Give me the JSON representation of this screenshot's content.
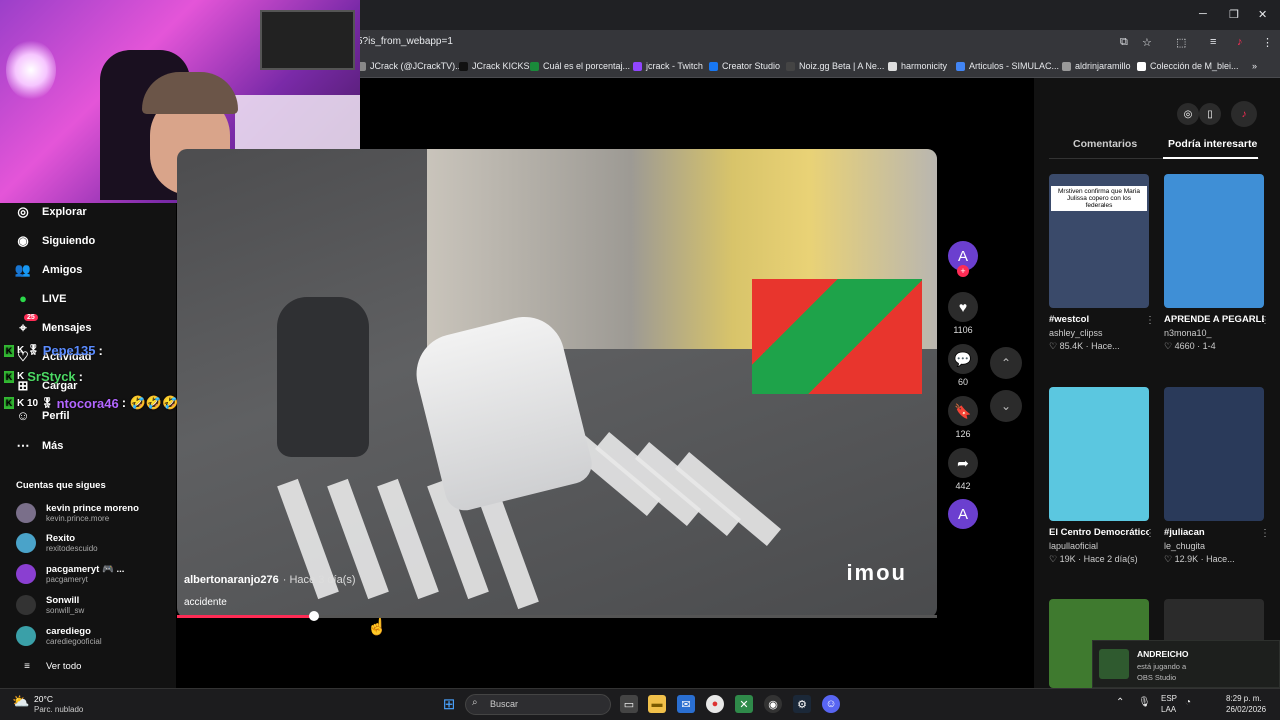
{
  "browser": {
    "url": "5?is_from_webapp=1",
    "bookmarks": [
      "JCrack (@JCrackTV)...",
      "JCrack KICKS",
      "Cuál es el porcentaj...",
      "jcrack - Twitch",
      "Creator Studio",
      "Noiz.gg Beta | A Ne...",
      "harmonicity",
      "Articulos - SIMULAC...",
      "aldrinjaramillo",
      "Colección de M_blei..."
    ],
    "bookmarks_more": "»"
  },
  "sidebar": {
    "nav": [
      {
        "icon": "compass-icon",
        "label": "Explorar"
      },
      {
        "icon": "following-icon",
        "label": "Siguiendo"
      },
      {
        "icon": "friends-icon",
        "label": "Amigos"
      },
      {
        "icon": "live-icon",
        "label": "LIVE"
      },
      {
        "icon": "messages-icon",
        "label": "Mensajes",
        "badge": "25"
      },
      {
        "icon": "activity-icon",
        "label": "Actividad"
      },
      {
        "icon": "upload-icon",
        "label": "Cargar"
      },
      {
        "icon": "profile-icon",
        "label": "Perfil"
      },
      {
        "icon": "more-icon",
        "label": "Más"
      }
    ],
    "following_header": "Cuentas que sigues",
    "following": [
      {
        "name": "kevin prince moreno",
        "handle": "kevin.prince.more",
        "color": "#7a6f8a"
      },
      {
        "name": "Rexito",
        "handle": "rexitodescuido",
        "color": "#4aa3c9"
      },
      {
        "name": "pacgameryt 🎮 ...",
        "handle": "pacgameryt",
        "color": "#8a3fd1"
      },
      {
        "name": "Sonwill",
        "handle": "sonwill_sw",
        "color": "#333333"
      },
      {
        "name": "carediego",
        "handle": "carediegooficial",
        "color": "#3aa0a8"
      }
    ],
    "see_all": "Ver todo"
  },
  "chat": [
    {
      "user": "Pepe135",
      "color": "#5b8cff",
      "text": ":",
      "badges": "K 🎖"
    },
    {
      "user": "SrStyck",
      "color": "#4cd964",
      "text": ":",
      "badges": "K"
    },
    {
      "user": "ntocora46",
      "color": "#b266ff",
      "text": ": 🤣🤣🤣🤣🤣",
      "badges": "K 10 🎖"
    }
  ],
  "video": {
    "author": "albertonaranjo276",
    "time": "· Hace 3 día(s)",
    "description": "accidente",
    "watermark": "imou",
    "progress": 0.18
  },
  "actions": {
    "likes": "1106",
    "comments": "60",
    "saves": "126",
    "shares": "442",
    "avatar_letter": "A"
  },
  "right_panel": {
    "tabs": [
      "Comentarios",
      "Podría interesarte"
    ],
    "active_tab": 1,
    "cards": [
      {
        "title": "#westcol",
        "author": "ashley_clipss",
        "stats": "♡ 85.4K · Hace...",
        "overlay": "Mrstiven confirma que Maria Julissa copero con los federales",
        "bg": "#3a4a6a"
      },
      {
        "title": "APRENDE A PEGARLE BIEN A...",
        "author": "n3mona10_",
        "stats": "♡ 4660 · 1-4",
        "overlay": "",
        "bg": "#3f8fd6"
      },
      {
        "title": "El Centro Democrático...",
        "author": "lapullaoficial",
        "stats": "♡ 19K · Hace 2 día(s)",
        "overlay": "",
        "bg": "#5bc7e0"
      },
      {
        "title": "#juliacan",
        "author": "le_chugita",
        "stats": "♡ 12.9K · Hace...",
        "overlay": "",
        "bg": "#2a3a5a"
      },
      {
        "title": "",
        "author": "",
        "stats": "",
        "overlay": "",
        "bg": "#3f7a2f"
      },
      {
        "title": "",
        "author": "",
        "stats": "",
        "overlay": "",
        "bg": "#2b2b2b"
      }
    ]
  },
  "notification": {
    "title": "ANDREICHO",
    "line1": "está jugando a",
    "line2": "OBS Studio"
  },
  "taskbar": {
    "temp": "20°C",
    "weather": "Parc. nublado",
    "search_placeholder": "Buscar",
    "lang1": "ESP",
    "lang2": "LAA",
    "time": "8:29 p. m.",
    "date": "26/02/2026"
  }
}
